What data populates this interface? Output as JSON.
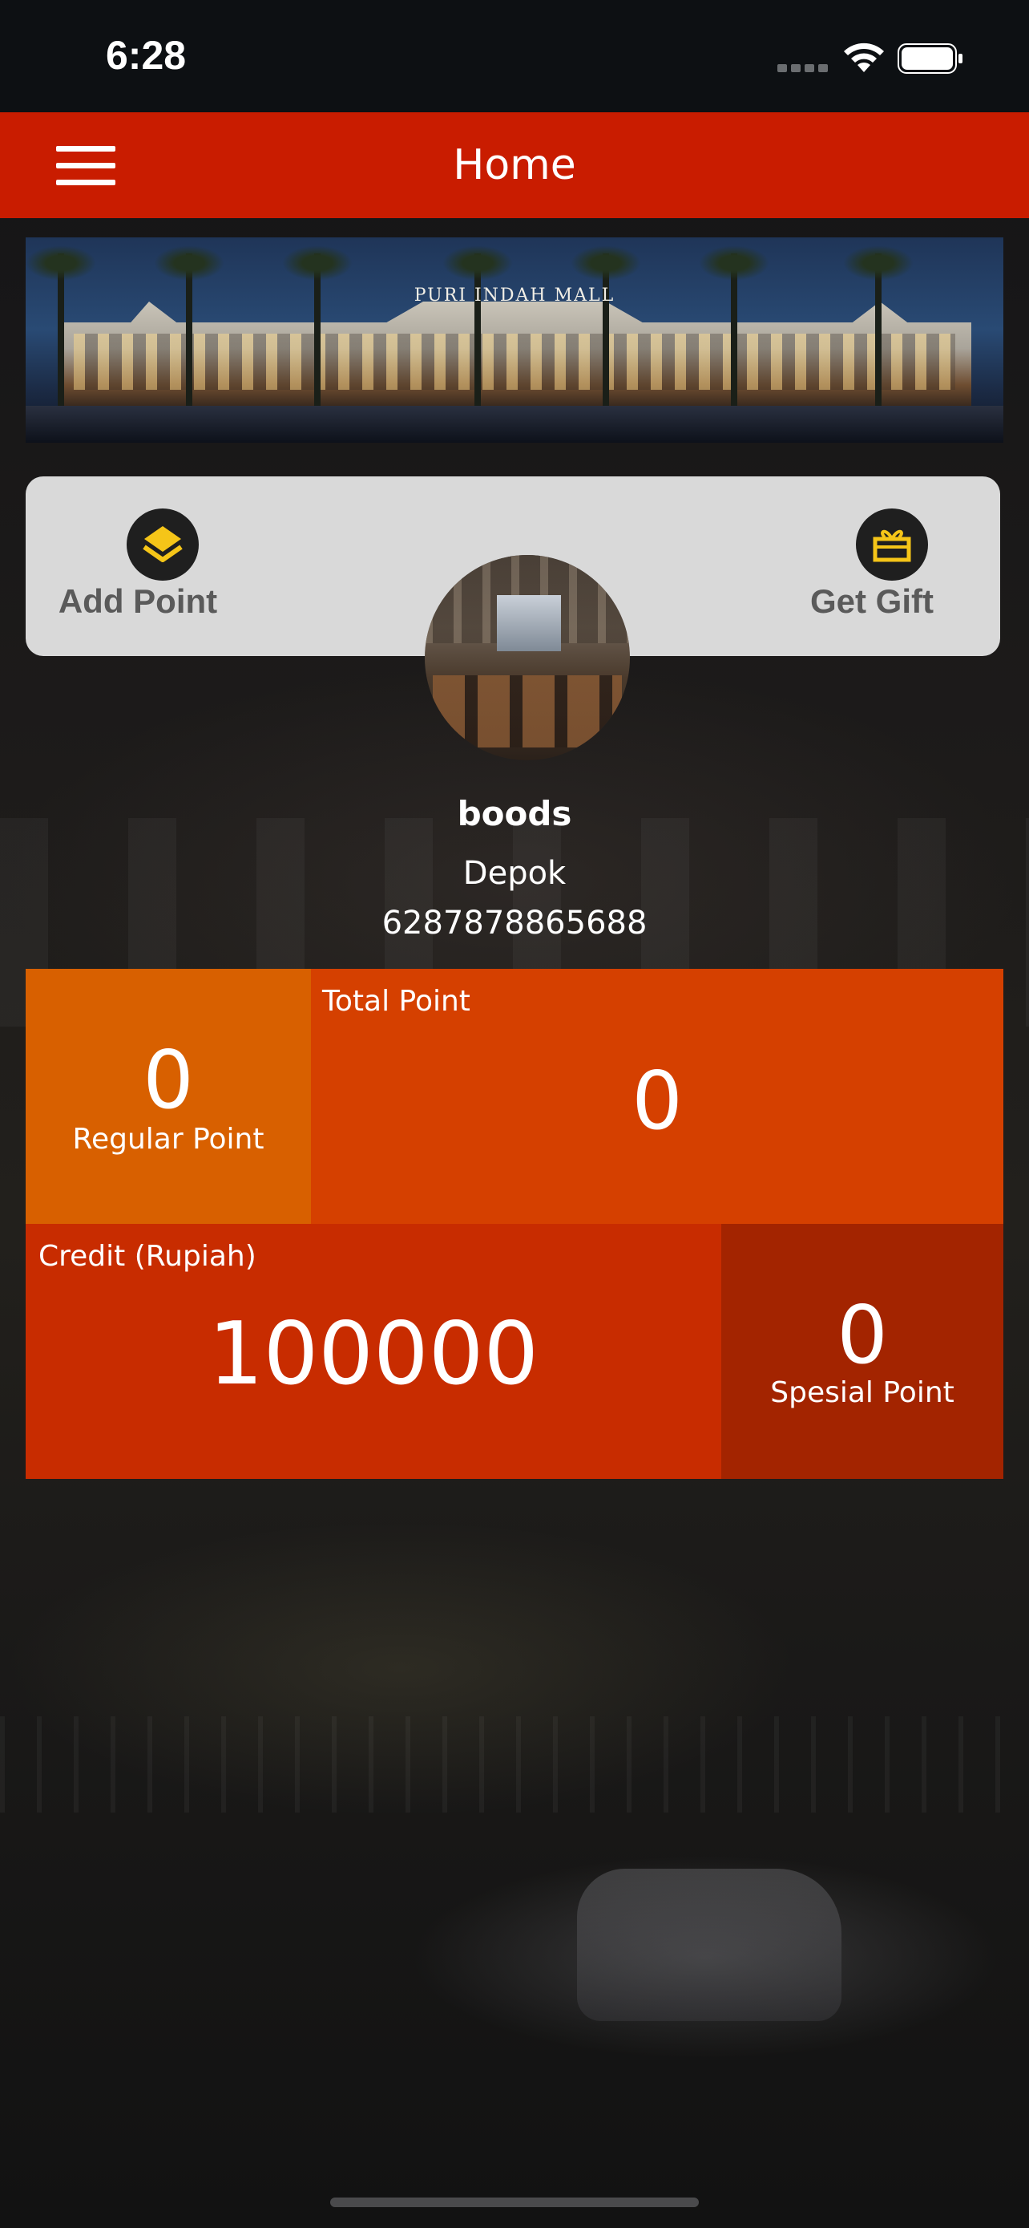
{
  "status_bar": {
    "time": "6:28"
  },
  "header": {
    "title": "Home"
  },
  "banner": {
    "caption": "PURI INDAH MALL"
  },
  "actions": {
    "add_point_label": "Add Point",
    "get_gift_label": "Get Gift"
  },
  "profile": {
    "name": "boods",
    "city": "Depok",
    "phone": "6287878865688"
  },
  "points": {
    "regular": {
      "value": "0",
      "label": "Regular Point"
    },
    "total": {
      "caption": "Total Point",
      "value": "0"
    },
    "credit": {
      "caption": "Credit (Rupiah)",
      "value": "100000"
    },
    "special": {
      "value": "0",
      "label": "Spesial Point"
    }
  },
  "colors": {
    "header": "#c91c00",
    "regular_tile": "#d86000",
    "total_tile": "#d54000",
    "credit_tile": "#c82c00",
    "special_tile": "#a32400",
    "icon_accent": "#f5c518"
  },
  "icons": {
    "menu": "hamburger-menu-icon",
    "add_point": "layers-icon",
    "get_gift": "gift-icon"
  }
}
